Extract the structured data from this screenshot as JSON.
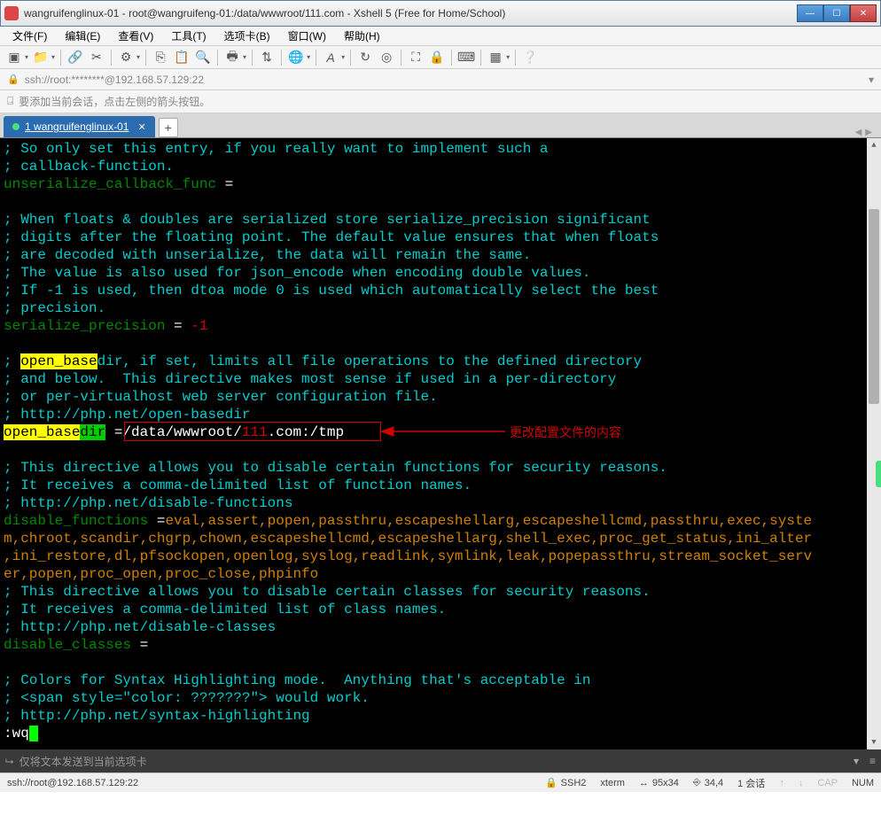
{
  "window": {
    "title": "wangruifenglinux-01 - root@wangruifeng-01:/data/wwwroot/111.com - Xshell 5 (Free for Home/School)"
  },
  "menu": {
    "file": "文件(F)",
    "edit": "编辑(E)",
    "view": "查看(V)",
    "tools": "工具(T)",
    "tabs": "选项卡(B)",
    "window": "窗口(W)",
    "help": "帮助(H)"
  },
  "address": {
    "url": "ssh://root:********@192.168.57.129:22"
  },
  "infobar": {
    "text": "要添加当前会话，点击左侧的箭头按钮。"
  },
  "tab": {
    "index": "1",
    "label": "wangruifenglinux-01"
  },
  "terminal": {
    "lines": [
      {
        "segs": [
          {
            "t": "; So only set this entry, if you really want to implement such a",
            "c": "c-cyan"
          }
        ]
      },
      {
        "segs": [
          {
            "t": "; callback-function.",
            "c": "c-cyan"
          }
        ]
      },
      {
        "segs": [
          {
            "t": "unserialize_callback_func",
            "c": "c-dgreen"
          },
          {
            "t": " =",
            "c": "c-white"
          }
        ]
      },
      {
        "segs": [
          {
            "t": " ",
            "c": ""
          }
        ]
      },
      {
        "segs": [
          {
            "t": "; When floats & doubles are serialized store serialize_precision significant",
            "c": "c-cyan"
          }
        ]
      },
      {
        "segs": [
          {
            "t": "; digits after the floating point. The default value ensures that when floats",
            "c": "c-cyan"
          }
        ]
      },
      {
        "segs": [
          {
            "t": "; are decoded with unserialize, the data will remain the same.",
            "c": "c-cyan"
          }
        ]
      },
      {
        "segs": [
          {
            "t": "; The value is also used for json_encode when encoding double values.",
            "c": "c-cyan"
          }
        ]
      },
      {
        "segs": [
          {
            "t": "; If -1 is used, then dtoa mode 0 is used which automatically select the best",
            "c": "c-cyan"
          }
        ]
      },
      {
        "segs": [
          {
            "t": "; precision.",
            "c": "c-cyan"
          }
        ]
      },
      {
        "segs": [
          {
            "t": "serialize_precision",
            "c": "c-dgreen"
          },
          {
            "t": " = ",
            "c": "c-white"
          },
          {
            "t": "-1",
            "c": "c-red"
          }
        ]
      },
      {
        "segs": [
          {
            "t": " ",
            "c": ""
          }
        ]
      },
      {
        "segs": [
          {
            "t": "; ",
            "c": "c-cyan"
          },
          {
            "t": "open_base",
            "c": "hl-yellow"
          },
          {
            "t": "dir, if set, limits all file operations to the defined directory",
            "c": "c-cyan"
          }
        ]
      },
      {
        "segs": [
          {
            "t": "; and below.  This directive makes most sense if used in a per-directory",
            "c": "c-cyan"
          }
        ]
      },
      {
        "segs": [
          {
            "t": "; or per-virtualhost web server configuration file.",
            "c": "c-cyan"
          }
        ]
      },
      {
        "segs": [
          {
            "t": "; http://php.net/open-basedir",
            "c": "c-cyan"
          }
        ]
      },
      {
        "segs": [
          {
            "t": "open_base",
            "c": "hl-yellow"
          },
          {
            "t": "dir",
            "c": "hl-green"
          },
          {
            "t": " =",
            "c": "c-white"
          },
          {
            "t": "/data/wwwroot/",
            "c": "c-white"
          },
          {
            "t": "111",
            "c": "c-red"
          },
          {
            "t": ".com:/tmp",
            "c": "c-white"
          }
        ]
      },
      {
        "segs": [
          {
            "t": " ",
            "c": ""
          }
        ]
      },
      {
        "segs": [
          {
            "t": "; This directive allows you to disable certain functions for security reasons.",
            "c": "c-cyan"
          }
        ]
      },
      {
        "segs": [
          {
            "t": "; It receives a comma-delimited list of function names.",
            "c": "c-cyan"
          }
        ]
      },
      {
        "segs": [
          {
            "t": "; http://php.net/disable-functions",
            "c": "c-cyan"
          }
        ]
      },
      {
        "segs": [
          {
            "t": "disable_functions",
            "c": "c-dgreen"
          },
          {
            "t": " =",
            "c": "c-white"
          },
          {
            "t": "eval,assert,popen,passthru,escapeshellarg,escapeshellcmd,passthru,exec,syste",
            "c": "c-orange"
          }
        ]
      },
      {
        "segs": [
          {
            "t": "m,chroot,scandir,chgrp,chown,escapeshellcmd,escapeshellarg,shell_exec,proc_get_status,ini_alter",
            "c": "c-orange"
          }
        ]
      },
      {
        "segs": [
          {
            "t": ",ini_restore,dl,pfsockopen,openlog,syslog,readlink,symlink,leak,popepassthru,stream_socket_serv",
            "c": "c-orange"
          }
        ]
      },
      {
        "segs": [
          {
            "t": "er,popen,proc_open,proc_close,phpinfo",
            "c": "c-orange"
          }
        ]
      },
      {
        "segs": [
          {
            "t": "; This directive allows you to disable certain classes for security reasons.",
            "c": "c-cyan"
          }
        ]
      },
      {
        "segs": [
          {
            "t": "; It receives a comma-delimited list of class names.",
            "c": "c-cyan"
          }
        ]
      },
      {
        "segs": [
          {
            "t": "; http://php.net/disable-classes",
            "c": "c-cyan"
          }
        ]
      },
      {
        "segs": [
          {
            "t": "disable_classes",
            "c": "c-dgreen"
          },
          {
            "t": " =",
            "c": "c-white"
          }
        ]
      },
      {
        "segs": [
          {
            "t": " ",
            "c": ""
          }
        ]
      },
      {
        "segs": [
          {
            "t": "; Colors for Syntax Highlighting mode.  Anything that's acceptable in",
            "c": "c-cyan"
          }
        ]
      },
      {
        "segs": [
          {
            "t": "; <span style=\"color: ???????\"> would work.",
            "c": "c-cyan"
          }
        ]
      },
      {
        "segs": [
          {
            "t": "; http://php.net/syntax-highlighting",
            "c": "c-cyan"
          }
        ]
      }
    ],
    "cmdline": ":wq"
  },
  "annotation": {
    "text": "更改配置文件的内容"
  },
  "input_bar": {
    "placeholder": "仅将文本发送到当前选项卡"
  },
  "status": {
    "left": "ssh://root@192.168.57.129:22",
    "proto": "SSH2",
    "term": "xterm",
    "size": "95x34",
    "pos": "34,4",
    "sessions": "1 会话",
    "cap": "CAP",
    "num": "NUM"
  }
}
